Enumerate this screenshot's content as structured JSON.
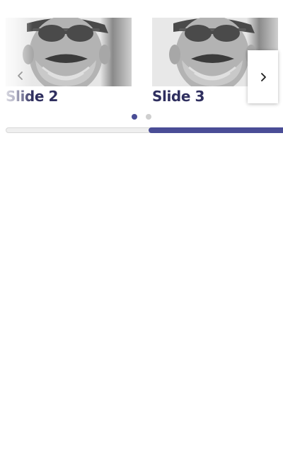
{
  "carousel": {
    "slides": [
      {
        "caption": "Slide 2",
        "image": "photo-portrait-man-sunglasses"
      },
      {
        "caption": "Slide 3",
        "image": "photo-portrait-man-sunglasses"
      }
    ],
    "prev_icon": "chevron-left-icon",
    "next_icon": "chevron-right-icon",
    "active_dot": 1,
    "dot_count": 2,
    "progress_fraction": 0.5,
    "colors": {
      "accent": "#4a4d96",
      "caption": "#2f2f5f",
      "dot_inactive": "#cfcfcf"
    }
  }
}
